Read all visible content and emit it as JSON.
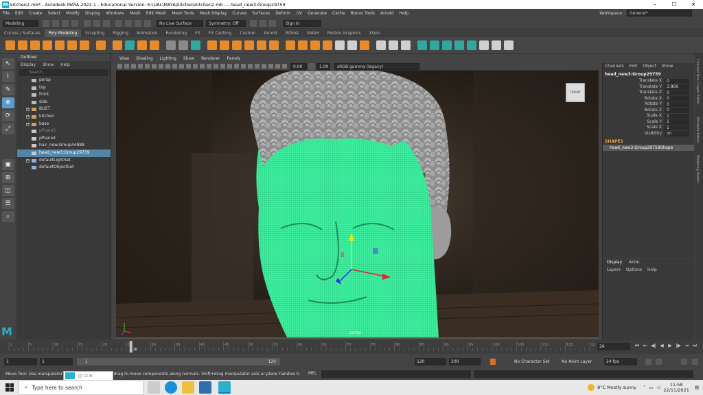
{
  "window": {
    "title": "kitchen2.mb* - Autodesk MAYA 2022.1 - Educational Version: E:\\UAL\\MAYA\\kitchen\\kitchen2.mb   ---   head_new3:Group29759",
    "logo": "M",
    "controls": [
      "–",
      "☐",
      "✕"
    ]
  },
  "menubar": {
    "items": [
      "File",
      "Edit",
      "Create",
      "Select",
      "Modify",
      "Display",
      "Windows",
      "Mesh",
      "Edit Mesh",
      "Mesh Tools",
      "Mesh Display",
      "Curves",
      "Surfaces",
      "Deform",
      "UV",
      "Generate",
      "Cache",
      "Bonus Tools",
      "Arnold",
      "Help"
    ],
    "workspace_label": "Workspace :",
    "workspace_value": "General*"
  },
  "statusline": {
    "mode": "Modeling",
    "live_surface": "No Live Surface",
    "symmetry": "Symmetry: Off",
    "sign_in": "Sign In"
  },
  "shelf": {
    "tabs": [
      "Curves / Surfaces",
      "Poly Modeling",
      "Sculpting",
      "Rigging",
      "Animation",
      "Rendering",
      "FX",
      "FX Caching",
      "Custom",
      "Arnold",
      "Bifrost",
      "MASH",
      "Motion Graphics",
      "XGen"
    ],
    "active_tab": "Poly Modeling"
  },
  "outliner": {
    "title": "Outliner",
    "menu": [
      "Display",
      "Show",
      "Help"
    ],
    "search_placeholder": "Search...",
    "items": [
      {
        "label": "persp",
        "type": "camera",
        "expand": false,
        "dim": false,
        "selected": false
      },
      {
        "label": "top",
        "type": "camera",
        "expand": false,
        "dim": false,
        "selected": false
      },
      {
        "label": "front",
        "type": "camera",
        "expand": false,
        "dim": false,
        "selected": false
      },
      {
        "label": "side",
        "type": "camera",
        "expand": false,
        "dim": false,
        "selected": false
      },
      {
        "label": "BUST",
        "type": "group",
        "expand": true,
        "dim": false,
        "selected": false
      },
      {
        "label": "kitchen",
        "type": "group",
        "expand": true,
        "dim": false,
        "selected": false
      },
      {
        "label": "base",
        "type": "group",
        "expand": true,
        "dim": false,
        "selected": false
      },
      {
        "label": "pPlane3",
        "type": "mesh",
        "expand": false,
        "dim": true,
        "selected": false
      },
      {
        "label": "pPlane4",
        "type": "mesh",
        "expand": false,
        "dim": false,
        "selected": false
      },
      {
        "label": "hair_new:Group44888",
        "type": "mesh",
        "expand": false,
        "dim": false,
        "selected": false
      },
      {
        "label": "head_new3:Group29759",
        "type": "mesh",
        "expand": false,
        "dim": false,
        "selected": true
      },
      {
        "label": "defaultLightSet",
        "type": "set",
        "expand": true,
        "dim": false,
        "selected": false
      },
      {
        "label": "defaultObjectSet",
        "type": "set",
        "expand": false,
        "dim": false,
        "selected": false
      }
    ]
  },
  "viewport": {
    "menu": [
      "View",
      "Shading",
      "Lighting",
      "Show",
      "Renderer",
      "Panels"
    ],
    "exposure": "0.00",
    "gamma": "1.00",
    "color_space": "sRGB gamma (legacy)",
    "camera_label": "persp",
    "viewcube_label": "FRONT"
  },
  "channelbox": {
    "tabs": [
      "Channels",
      "Edit",
      "Object",
      "Show"
    ],
    "object_name": "head_new3:Group29759",
    "attributes": [
      {
        "name": "Translate X",
        "value": "0"
      },
      {
        "name": "Translate Y",
        "value": "3.866"
      },
      {
        "name": "Translate Z",
        "value": "0"
      },
      {
        "name": "Rotate X",
        "value": "0"
      },
      {
        "name": "Rotate Y",
        "value": "0"
      },
      {
        "name": "Rotate Z",
        "value": "0"
      },
      {
        "name": "Scale X",
        "value": "1"
      },
      {
        "name": "Scale Y",
        "value": "1"
      },
      {
        "name": "Scale Z",
        "value": "1"
      },
      {
        "name": "Visibility",
        "value": "on"
      }
    ],
    "shapes_label": "SHAPES",
    "shape_name": "head_new3:Group29759Shape"
  },
  "layers": {
    "tabs": [
      "Display",
      "Anim"
    ],
    "menu": [
      "Layers",
      "Options",
      "Help"
    ]
  },
  "side_tabs": [
    "Channel Box / Layer Editor",
    "Attribute Editor",
    "Modeling Toolkit"
  ],
  "timeline": {
    "ticks": [
      "1",
      "5",
      "10",
      "15",
      "20",
      "25",
      "30",
      "35",
      "40",
      "45",
      "50",
      "55",
      "60",
      "65",
      "70",
      "75",
      "80",
      "85",
      "90",
      "95",
      "100",
      "105",
      "110",
      "115",
      "120"
    ],
    "playhead_frame": "26",
    "current_frame": "26",
    "playback_controls": [
      "⏮",
      "⇤",
      "◀|",
      "◀",
      "▶",
      "|▶",
      "⇥",
      "⏭"
    ]
  },
  "range": {
    "start": "1",
    "playback_start": "1",
    "slider_start": "1",
    "slider_end": "120",
    "playback_end": "120",
    "end": "200",
    "character_set": "No Character Set",
    "anim_layer": "No Anim Layer",
    "fps": "24 fps"
  },
  "commandline": {
    "help_text": "Move Tool: Use manipulator to move object(s). Ctrl+drag to move components along normals. Shift+drag manipulator axis or plane handles to extrude components or c",
    "mel_label": "MEL"
  },
  "ghost_window": {
    "label": "⬜  ☐  ✕"
  },
  "taskbar": {
    "search_placeholder": "Type here to search",
    "weather": "8°C  Mostly sunny",
    "time": "11:58",
    "date": "22/11/2021"
  },
  "colors": {
    "wireframe": "#3ef0a0",
    "selection": "#5285a6",
    "accent_orange": "#e88a2a",
    "maya_teal": "#2ab0c9"
  }
}
